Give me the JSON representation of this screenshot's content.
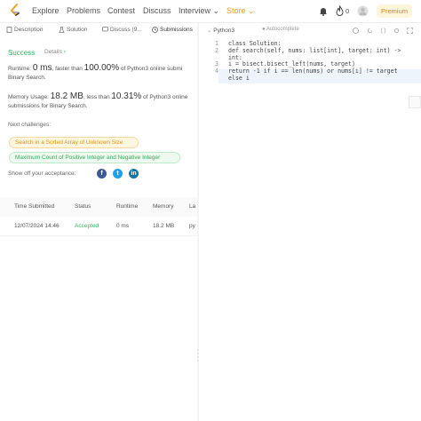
{
  "nav": {
    "links": [
      "Explore",
      "Problems",
      "Contest",
      "Discuss",
      "Interview",
      "Store"
    ],
    "notification_count": "0",
    "premium_label": "Premium"
  },
  "left_tabs": [
    "Description",
    "Solution",
    "Discuss (9...",
    "Submissions"
  ],
  "submission": {
    "status": "Success",
    "details_label": "Details",
    "runtime_prefix": "Runtime: ",
    "runtime_value": "0 ms",
    "runtime_mid": ", faster than ",
    "runtime_percent": "100.00%",
    "runtime_suffix": " of Python3 online submi",
    "runtime_line2": "Binary Search.",
    "memory_prefix": "Memory Usage: ",
    "memory_value": "18.2 MB",
    "memory_mid": ", less than ",
    "memory_percent": "10.31%",
    "memory_suffix": " of Python3 online",
    "memory_line2": "submissions for Binary Search.",
    "next_label": "Next challenges:",
    "challenges": [
      "Search in a Sorted Array of Unknown Size",
      "Maximum Count of Positive Integer and Negative Integer"
    ],
    "share_label": "Show off your acceptance:"
  },
  "table": {
    "headers": [
      "Time Submitted",
      "Status",
      "Runtime",
      "Memory",
      "La"
    ],
    "rows": [
      [
        "12/07/2024 14:46",
        "Accepted",
        "0 ms",
        "18.2 MB",
        "py"
      ]
    ]
  },
  "editor": {
    "language": "Python3",
    "autocomplete_label": "Autocomplete",
    "line_numbers": [
      "1",
      "2",
      "",
      "3",
      "4",
      ""
    ],
    "code_lines": [
      "class Solution:",
      "    def search(self, nums: list[int], target: int) ->",
      "int:",
      "        i = bisect.bisect_left(nums, target)",
      "        return -1 if i == len(nums) or nums[i] != target",
      "else i"
    ]
  },
  "colors": {
    "success": "#2db55d",
    "store": "#f0a020",
    "premium_bg": "#fff4dc",
    "premium_text": "#d28b11"
  },
  "icons": [
    "leetcode-logo",
    "bell-icon",
    "fire-icon",
    "user-avatar-icon",
    "facebook-icon",
    "twitter-icon",
    "linkedin-icon"
  ]
}
